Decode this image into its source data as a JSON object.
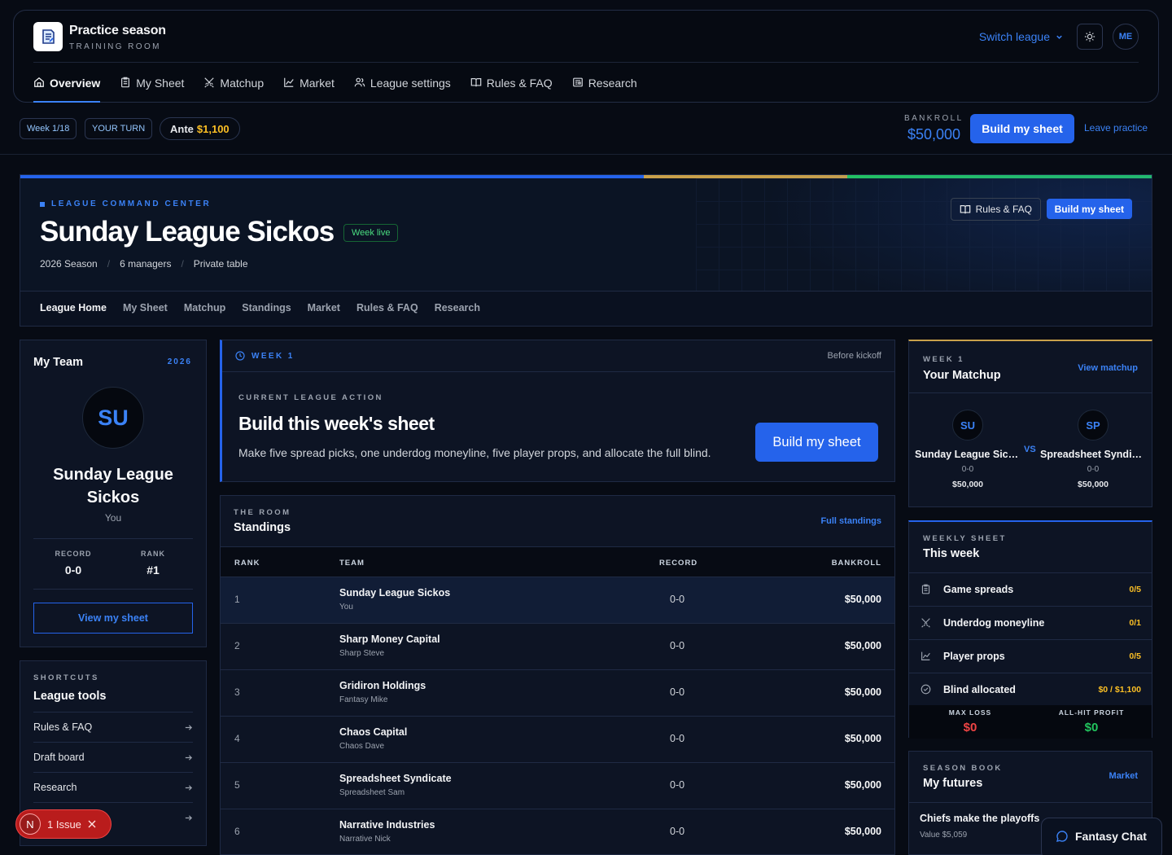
{
  "app": {
    "name": "Practice season",
    "subtitle": "TRAINING ROOM"
  },
  "header": {
    "switch_league": "Switch league",
    "avatar": "ME"
  },
  "main_nav": [
    {
      "label": "Overview",
      "icon": "home-icon",
      "active": true
    },
    {
      "label": "My Sheet",
      "icon": "clipboard-icon"
    },
    {
      "label": "Matchup",
      "icon": "swords-icon"
    },
    {
      "label": "Market",
      "icon": "chart-line-icon"
    },
    {
      "label": "League settings",
      "icon": "users-icon"
    },
    {
      "label": "Rules & FAQ",
      "icon": "book-icon"
    },
    {
      "label": "Research",
      "icon": "newspaper-icon"
    }
  ],
  "status_bar": {
    "week": "Week 1/18",
    "turn": "YOUR TURN",
    "ante_label": "Ante",
    "ante_value": "$1,100",
    "bankroll_label": "BANKROLL",
    "bankroll_value": "$50,000",
    "build_button": "Build my sheet",
    "leave": "Leave practice"
  },
  "league": {
    "kicker": "LEAGUE COMMAND CENTER",
    "title": "Sunday League Sickos",
    "badge": "Week live",
    "meta": [
      "2026 Season",
      "6 managers",
      "Private table"
    ],
    "rules_button": "Rules & FAQ",
    "build_button": "Build my sheet",
    "tabs": [
      "League Home",
      "My Sheet",
      "Matchup",
      "Standings",
      "Market",
      "Rules & FAQ",
      "Research"
    ],
    "accent_colors": [
      "#2563eb",
      "#c8a04a",
      "#22c55e"
    ]
  },
  "my_team": {
    "title": "My Team",
    "year": "2026",
    "initials": "SU",
    "name": "Sunday League Sickos",
    "owner": "You",
    "record_label": "RECORD",
    "record": "0-0",
    "rank_label": "RANK",
    "rank": "#1",
    "view_button": "View my sheet"
  },
  "tools": {
    "eyebrow": "SHORTCUTS",
    "title": "League tools",
    "items": [
      "Rules & FAQ",
      "Draft board",
      "Research",
      ""
    ]
  },
  "action": {
    "week": "WEEK 1",
    "status": "Before kickoff",
    "eyebrow": "CURRENT LEAGUE ACTION",
    "title": "Build this week's sheet",
    "description": "Make five spread picks, one underdog moneyline, five player props, and allocate the full blind.",
    "button": "Build my sheet"
  },
  "standings": {
    "eyebrow": "THE ROOM",
    "title": "Standings",
    "link": "Full standings",
    "columns": [
      "RANK",
      "TEAM",
      "RECORD",
      "BANKROLL"
    ],
    "rows": [
      {
        "rank": "1",
        "team": "Sunday League Sickos",
        "owner": "You",
        "record": "0-0",
        "bankroll": "$50,000"
      },
      {
        "rank": "2",
        "team": "Sharp Money Capital",
        "owner": "Sharp Steve",
        "record": "0-0",
        "bankroll": "$50,000"
      },
      {
        "rank": "3",
        "team": "Gridiron Holdings",
        "owner": "Fantasy Mike",
        "record": "0-0",
        "bankroll": "$50,000"
      },
      {
        "rank": "4",
        "team": "Chaos Capital",
        "owner": "Chaos Dave",
        "record": "0-0",
        "bankroll": "$50,000"
      },
      {
        "rank": "5",
        "team": "Spreadsheet Syndicate",
        "owner": "Spreadsheet Sam",
        "record": "0-0",
        "bankroll": "$50,000"
      },
      {
        "rank": "6",
        "team": "Narrative Industries",
        "owner": "Narrative Nick",
        "record": "0-0",
        "bankroll": "$50,000"
      }
    ]
  },
  "matchup": {
    "eyebrow": "WEEK 1",
    "title": "Your Matchup",
    "link": "View matchup",
    "vs": "VS",
    "home": {
      "initials": "SU",
      "name": "Sunday League Sickos",
      "record": "0-0",
      "bankroll": "$50,000"
    },
    "away": {
      "initials": "SP",
      "name": "Spreadsheet Syndicate",
      "record": "0-0",
      "bankroll": "$50,000"
    }
  },
  "weekly": {
    "eyebrow": "WEEKLY SHEET",
    "title": "This week",
    "rows": [
      {
        "label": "Game spreads",
        "value": "0/5",
        "icon": "clipboard-icon"
      },
      {
        "label": "Underdog moneyline",
        "value": "0/1",
        "icon": "swords-icon"
      },
      {
        "label": "Player props",
        "value": "0/5",
        "icon": "chart-line-icon"
      },
      {
        "label": "Blind allocated",
        "value": "$0 / $1,100",
        "icon": "check-circle-icon"
      }
    ],
    "max_loss_label": "MAX LOSS",
    "max_loss": "$0",
    "profit_label": "ALL-HIT PROFIT",
    "profit": "$0"
  },
  "futures": {
    "eyebrow": "SEASON BOOK",
    "title": "My futures",
    "link": "Market",
    "item": "Chiefs make the playoffs",
    "value": "Value $5,059"
  },
  "chat": {
    "label": "Fantasy Chat"
  },
  "issue": {
    "badge": "N",
    "label": "1 Issue"
  }
}
